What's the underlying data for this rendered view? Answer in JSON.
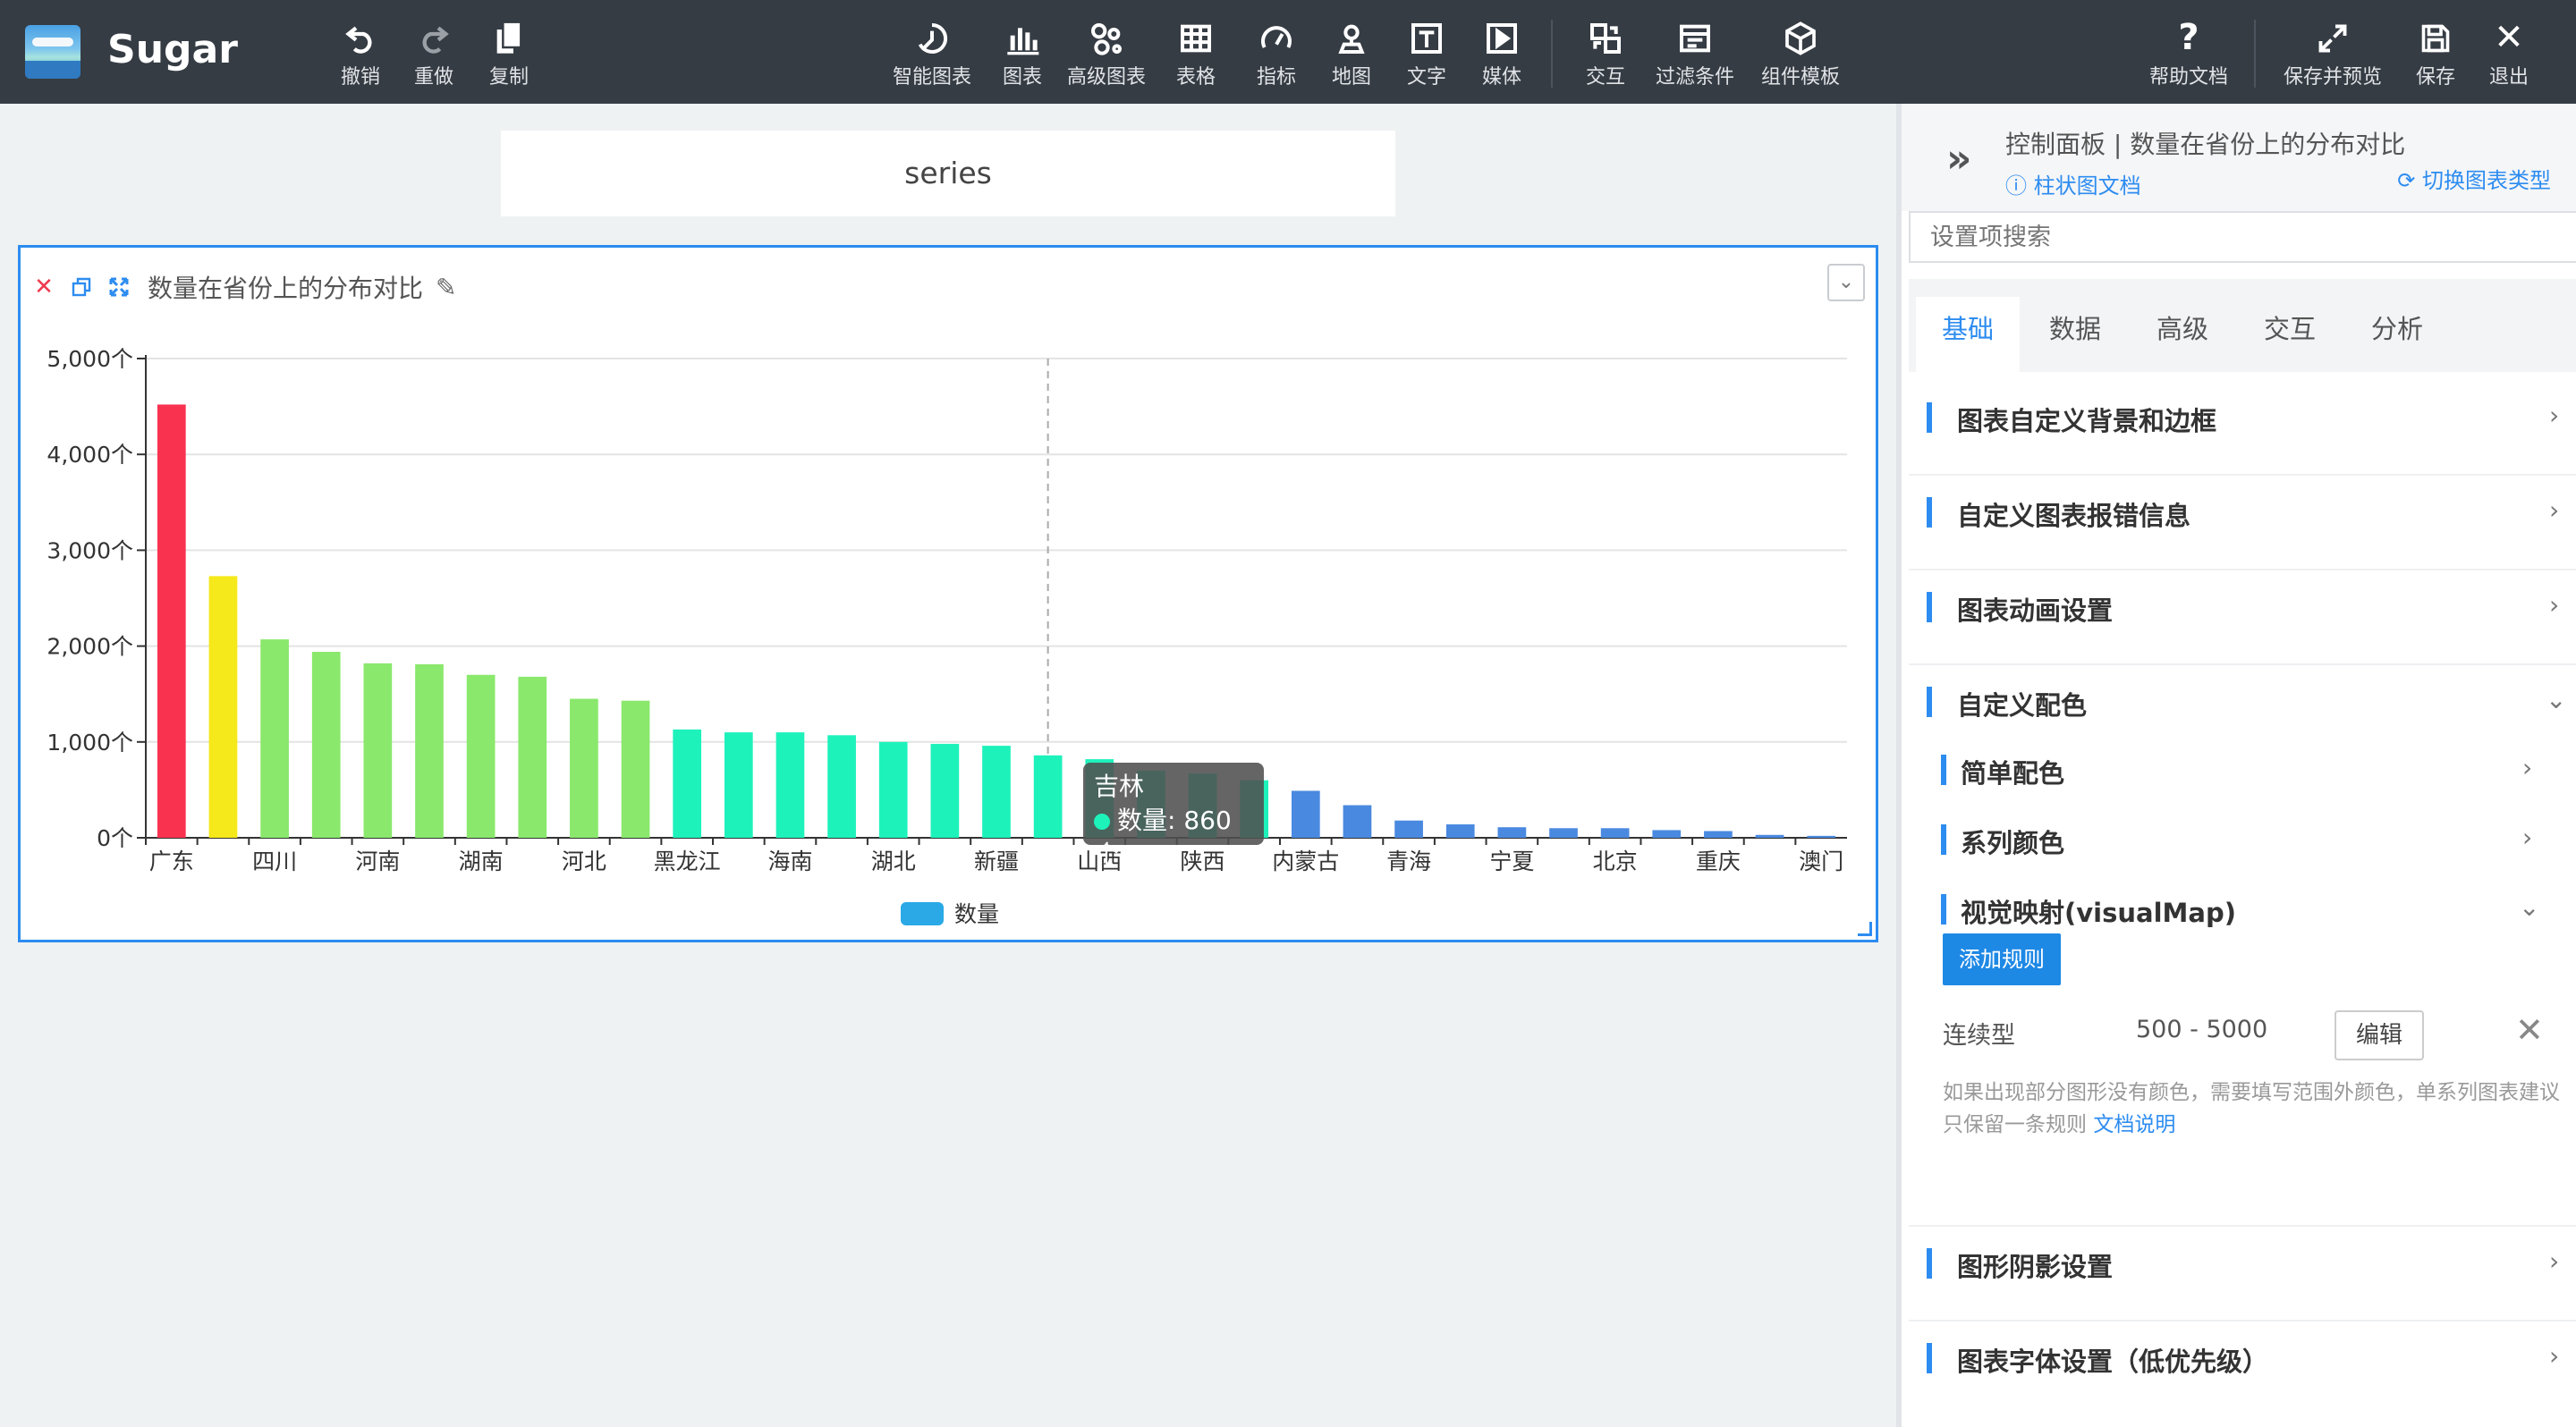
{
  "app": {
    "name": "Sugar"
  },
  "toolbar": {
    "left": [
      {
        "label": "撤销",
        "icon": "undo-icon"
      },
      {
        "label": "重做",
        "icon": "redo-icon"
      },
      {
        "label": "复制",
        "icon": "copy-icon"
      }
    ],
    "center": [
      {
        "label": "智能图表",
        "icon": "smart-chart-icon"
      },
      {
        "label": "图表",
        "icon": "bar-chart-icon"
      },
      {
        "label": "高级图表",
        "icon": "advanced-chart-icon"
      },
      {
        "label": "表格",
        "icon": "table-icon"
      },
      {
        "label": "指标",
        "icon": "gauge-icon"
      },
      {
        "label": "地图",
        "icon": "map-pin-icon"
      },
      {
        "label": "文字",
        "icon": "text-icon"
      },
      {
        "label": "媒体",
        "icon": "media-icon"
      },
      {
        "label": "交互",
        "icon": "interaction-icon"
      },
      {
        "label": "过滤条件",
        "icon": "filter-icon"
      },
      {
        "label": "组件模板",
        "icon": "template-icon"
      }
    ],
    "right": [
      {
        "label": "帮助文档",
        "icon": "help-icon"
      },
      {
        "label": "保存并预览",
        "icon": "expand-icon"
      },
      {
        "label": "保存",
        "icon": "save-icon"
      },
      {
        "label": "退出",
        "icon": "exit-icon"
      }
    ]
  },
  "canvas": {
    "title_box": "series"
  },
  "card": {
    "title": "数量在省份上的分布对比",
    "tooltip": {
      "category": "吉林",
      "series": "数量",
      "value": "860个"
    }
  },
  "chart_data": {
    "type": "bar",
    "title": "数量在省份上的分布对比",
    "categories": [
      "广东",
      "",
      "四川",
      "",
      "河南",
      "",
      "湖南",
      "",
      "河北",
      "",
      "黑龙江",
      "",
      "海南",
      "",
      "湖北",
      "",
      "新疆",
      "",
      "山西",
      "",
      "陕西",
      "",
      "内蒙古",
      "",
      "青海",
      "",
      "宁夏",
      "",
      "北京",
      "",
      "重庆",
      "",
      "澳门"
    ],
    "series": [
      {
        "name": "数量",
        "values": [
          4520,
          2730,
          2070,
          1940,
          1820,
          1810,
          1700,
          1680,
          1450,
          1430,
          1130,
          1100,
          1100,
          1070,
          1000,
          980,
          960,
          860,
          820,
          700,
          670,
          600,
          490,
          340,
          180,
          140,
          110,
          100,
          100,
          80,
          70,
          30,
          20
        ]
      }
    ],
    "y_ticks": [
      "0个",
      "1,000个",
      "2,000个",
      "3,000个",
      "4,000个",
      "5,000个"
    ],
    "ylim": [
      0,
      5000
    ],
    "grid": true,
    "legend": "bottom-center",
    "highlight_index": 17,
    "colors": {
      "high": "#f8324f",
      "mid_high": "#f5e81b",
      "mid": "#8ae86c",
      "low_mid": "#1ef2bb",
      "low": "#4a89e0",
      "legend": "#2aa9e6"
    }
  },
  "panel": {
    "title": "控制面板 | 数量在省份上的分布对比",
    "doc_link": "柱状图文档",
    "switch_link": "切换图表类型",
    "search_placeholder": "设置项搜索",
    "tabs": [
      "基础",
      "数据",
      "高级",
      "交互",
      "分析"
    ],
    "sections": {
      "bg": "图表自定义背景和边框",
      "err": "自定义图表报错信息",
      "anim": "图表动画设置",
      "color": "自定义配色",
      "simple": "简单配色",
      "series": "系列颜色",
      "visual": "视觉映射(visualMap)",
      "shadow": "图形阴影设置",
      "font": "图表字体设置（低优先级）"
    },
    "add_rule": "添加规则",
    "rule": {
      "type": "连续型",
      "range": "500 - 5000",
      "edit": "编辑"
    },
    "note": "如果出现部分图形没有颜色，需要填写范围外颜色，单系列图表建议只保留一条规则",
    "note_link": "文档说明"
  }
}
